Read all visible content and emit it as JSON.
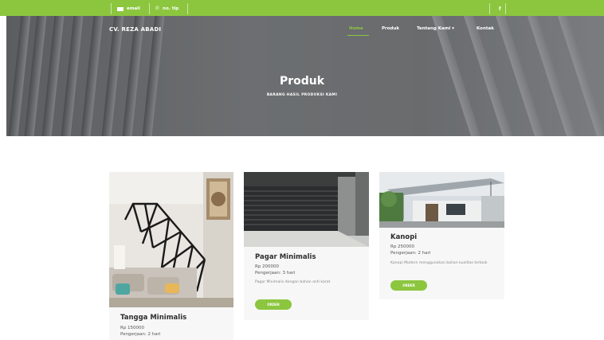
{
  "topbar": {
    "email": "email",
    "phone": "no. tlp",
    "facebook": "f"
  },
  "brand": "CV. REZA ABADI",
  "nav": {
    "home": "Home",
    "produk": "Produk",
    "tentang": "Tentang Kami ▾",
    "kontak": "Kontak"
  },
  "hero": {
    "title": "Produk",
    "subtitle": "BARANG HASIL PRODUKSI KAMI"
  },
  "products": [
    {
      "title": "Tangga Minimalis",
      "price": "Rp 150000",
      "work": "Pengerjaan: 2 hari"
    },
    {
      "title": "Pagar Minimalis",
      "price": "Rp 200000",
      "work": "Pengerjaan: 3 hari",
      "desc": "Pagar Minimalis dengan bahan anti karat",
      "button": "ORDER"
    },
    {
      "title": "Kanopi",
      "price": "Rp 250000",
      "work": "Pengerjaan: 2 hari",
      "desc": "Kanopi Modern menggunakan bahan kualitas terbaik",
      "button": "ORDER"
    }
  ]
}
